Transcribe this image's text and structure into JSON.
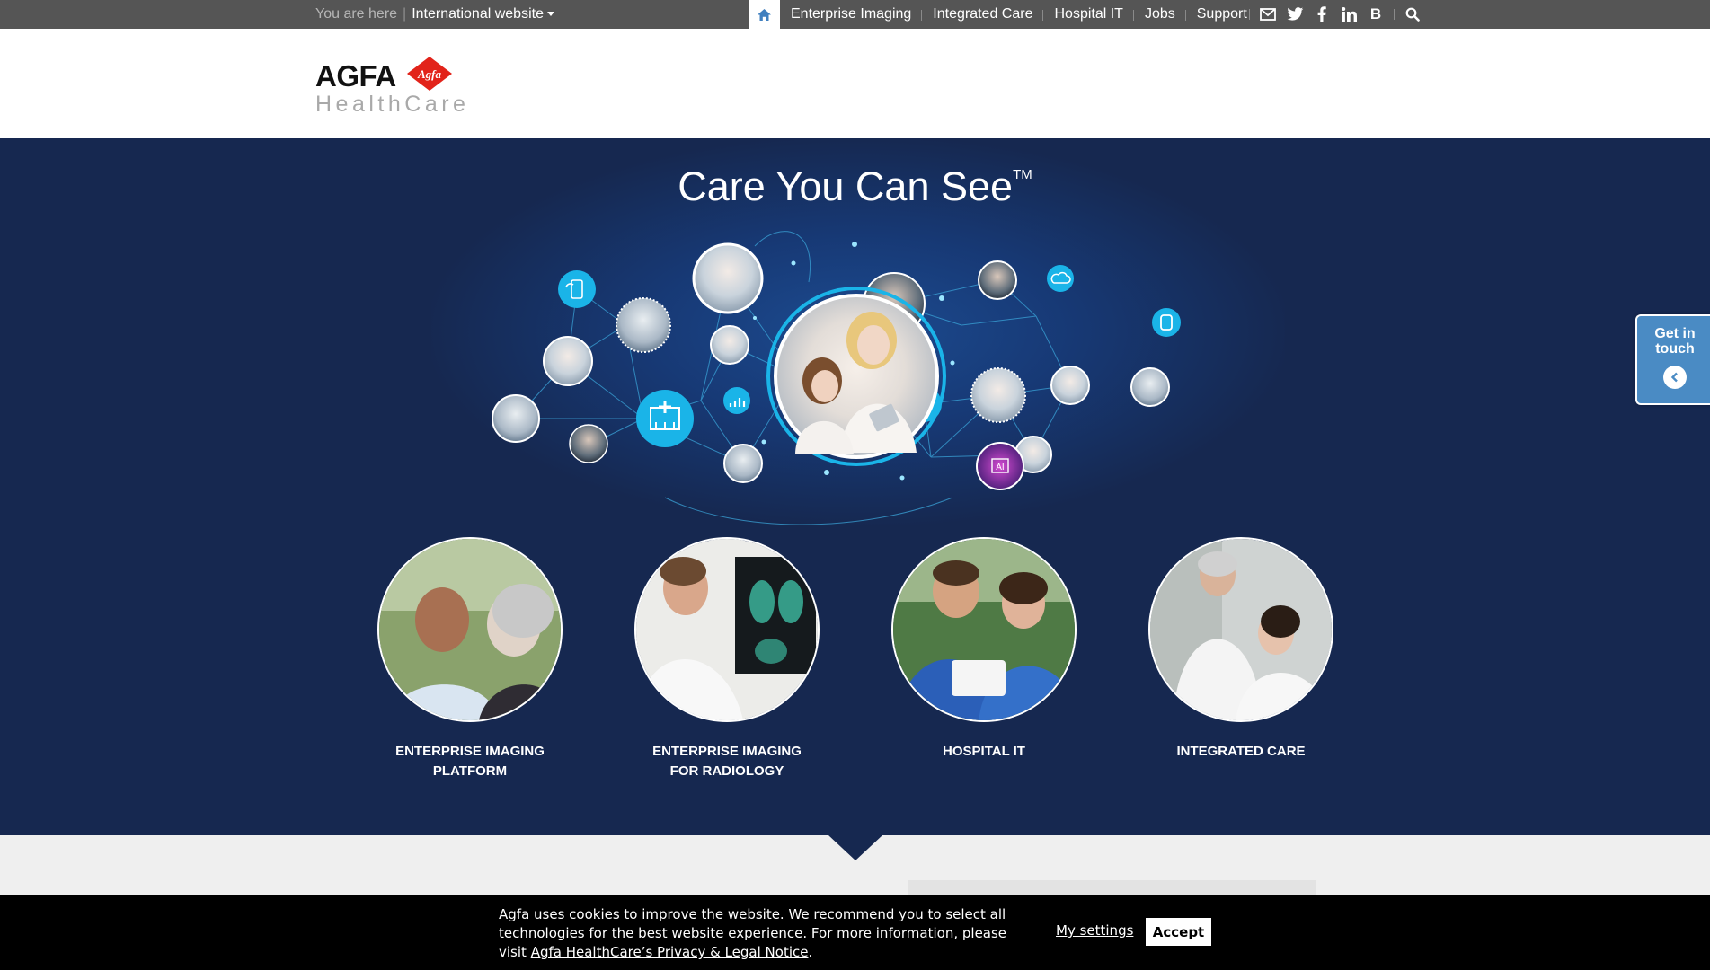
{
  "topbar": {
    "you_are_here": "You are here",
    "site_selector": "International website",
    "nav": [
      {
        "label": "Enterprise Imaging"
      },
      {
        "label": "Integrated Care"
      },
      {
        "label": "Hospital IT"
      },
      {
        "label": "Jobs"
      },
      {
        "label": "Support"
      }
    ],
    "social_icons": [
      "mail-icon",
      "twitter-icon",
      "facebook-icon",
      "linkedin-icon",
      "blog-icon",
      "search-icon"
    ],
    "blog_glyph": "B"
  },
  "logo": {
    "wordmark": "AGFA",
    "diamond_text": "Agfa",
    "subtitle": "HealthCare"
  },
  "hero": {
    "title": "Care You Can See",
    "trademark": "TM",
    "network_icons": [
      "cloud-phone-icon",
      "hospital-icon",
      "chart-icon",
      "home-icon",
      "cloud-icon",
      "watch-icon",
      "ai-icon"
    ],
    "cards": [
      {
        "line1": "ENTERPRISE IMAGING",
        "line2": "PLATFORM"
      },
      {
        "line1": "ENTERPRISE IMAGING",
        "line2": "FOR RADIOLOGY"
      },
      {
        "line1": "HOSPITAL IT",
        "line2": ""
      },
      {
        "line1": "INTEGRATED CARE",
        "line2": ""
      }
    ]
  },
  "get_in_touch": {
    "line1": "Get in",
    "line2": "touch"
  },
  "cookie": {
    "message_start": "Agfa uses cookies to improve the website. We recommend you to select all technologies for the best website experience. For more information, please visit ",
    "link_text": "Agfa HealthCare’s Privacy & Legal Notice",
    "message_end": ".",
    "settings": "My settings",
    "accept": "Accept"
  },
  "colors": {
    "topbar": "#555555",
    "hero_bg": "#162850",
    "accent": "#1ab4e8",
    "touch": "#4a8bc4",
    "logo_red": "#e2231a"
  }
}
